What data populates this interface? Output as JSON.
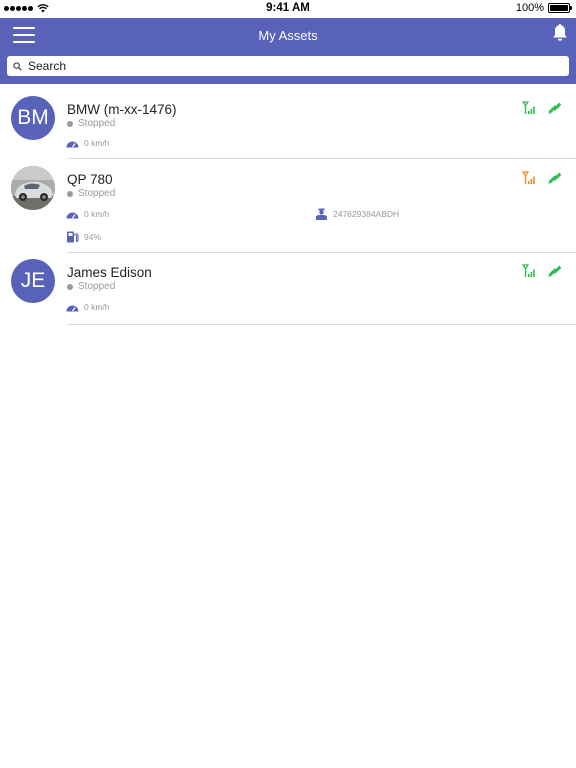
{
  "status_bar": {
    "time": "9:41 AM",
    "battery": "100%"
  },
  "header": {
    "title": "My Assets"
  },
  "search": {
    "placeholder": "Search"
  },
  "colors": {
    "primary": "#5762b8",
    "signal_green": "#2bbd4e",
    "signal_orange": "#f18a1f"
  },
  "assets": [
    {
      "initials": "BM",
      "name": "BMW (m-xx-1476)",
      "status": "Stopped",
      "speed": "0 km/h",
      "signal": "green"
    },
    {
      "initials": "",
      "name": "QP 780",
      "status": "Stopped",
      "speed": "0 km/h",
      "driver_id": "247629384ABDH",
      "fuel": "94%",
      "signal": "orange"
    },
    {
      "initials": "JE",
      "name": "James Edison",
      "status": "Stopped",
      "speed": "0 km/h",
      "signal": "green"
    }
  ]
}
